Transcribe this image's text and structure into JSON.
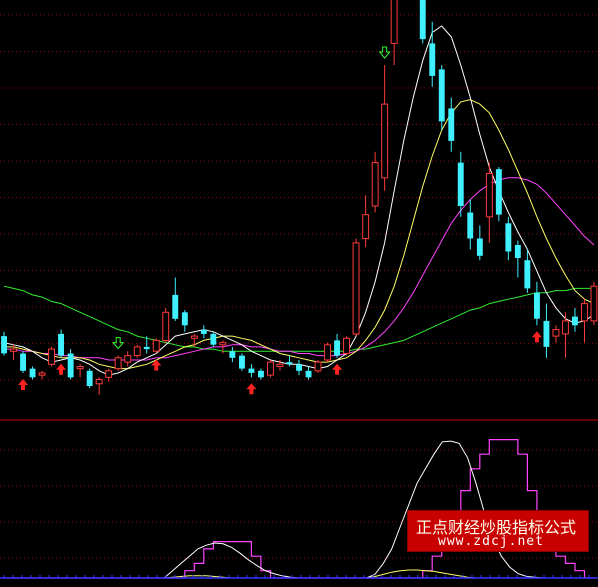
{
  "colors": {
    "background": "#000000",
    "grid": "#8b0000",
    "divider": "#cc0000",
    "up_candle": "#ff3b3b",
    "down_candle": "#3ff0ff",
    "ma_short": "#ffffff",
    "ma_mid": "#ffff66",
    "ma_long": "#ff44ff",
    "ma_longest": "#33ee33",
    "buy_arrow": "#ff2222",
    "sell_arrow": "#33ff33",
    "indicator_step": "#ff44ff",
    "indicator_smooth": "#ffffff",
    "indicator_low": "#ffff66",
    "baseline": "#3333ff"
  },
  "chart_data": {
    "type": "candlestick",
    "grid": true,
    "candles": [
      {
        "o": 55,
        "h": 57,
        "l": 46,
        "c": 47
      },
      {
        "o": 48,
        "h": 51,
        "l": 44,
        "c": 49
      },
      {
        "o": 47,
        "h": 48,
        "l": 38,
        "c": 39
      },
      {
        "o": 40,
        "h": 41,
        "l": 35,
        "c": 36
      },
      {
        "o": 37,
        "h": 39,
        "l": 35,
        "c": 38
      },
      {
        "o": 42,
        "h": 50,
        "l": 41,
        "c": 49
      },
      {
        "o": 56,
        "h": 58,
        "l": 45,
        "c": 46
      },
      {
        "o": 47,
        "h": 49,
        "l": 35,
        "c": 36
      },
      {
        "o": 40,
        "h": 42,
        "l": 36,
        "c": 41
      },
      {
        "o": 39,
        "h": 40,
        "l": 31,
        "c": 32
      },
      {
        "o": 33,
        "h": 36,
        "l": 28,
        "c": 35
      },
      {
        "o": 36,
        "h": 40,
        "l": 34,
        "c": 39
      },
      {
        "o": 40,
        "h": 46,
        "l": 39,
        "c": 45
      },
      {
        "o": 43,
        "h": 48,
        "l": 41,
        "c": 46
      },
      {
        "o": 46,
        "h": 51,
        "l": 45,
        "c": 50
      },
      {
        "o": 50,
        "h": 55,
        "l": 47,
        "c": 49
      },
      {
        "o": 48,
        "h": 54,
        "l": 47,
        "c": 53
      },
      {
        "o": 53,
        "h": 68,
        "l": 52,
        "c": 66
      },
      {
        "o": 74,
        "h": 82,
        "l": 62,
        "c": 63
      },
      {
        "o": 66,
        "h": 67,
        "l": 57,
        "c": 60
      },
      {
        "o": 54,
        "h": 56,
        "l": 50,
        "c": 55
      },
      {
        "o": 58,
        "h": 60,
        "l": 54,
        "c": 56
      },
      {
        "o": 56,
        "h": 57,
        "l": 50,
        "c": 51
      },
      {
        "o": 51,
        "h": 53,
        "l": 47,
        "c": 52
      },
      {
        "o": 48,
        "h": 50,
        "l": 43,
        "c": 45
      },
      {
        "o": 46,
        "h": 47,
        "l": 39,
        "c": 40
      },
      {
        "o": 40,
        "h": 42,
        "l": 36,
        "c": 38
      },
      {
        "o": 39,
        "h": 40,
        "l": 35,
        "c": 36
      },
      {
        "o": 37,
        "h": 44,
        "l": 36,
        "c": 43
      },
      {
        "o": 41,
        "h": 44,
        "l": 39,
        "c": 42
      },
      {
        "o": 43,
        "h": 46,
        "l": 41,
        "c": 42
      },
      {
        "o": 42,
        "h": 44,
        "l": 37,
        "c": 39
      },
      {
        "o": 39,
        "h": 41,
        "l": 35,
        "c": 36
      },
      {
        "o": 39,
        "h": 44,
        "l": 38,
        "c": 43
      },
      {
        "o": 44,
        "h": 52,
        "l": 43,
        "c": 51
      },
      {
        "o": 53,
        "h": 56,
        "l": 45,
        "c": 46
      },
      {
        "o": 47,
        "h": 55,
        "l": 46,
        "c": 54
      },
      {
        "o": 56,
        "h": 100,
        "l": 55,
        "c": 98
      },
      {
        "o": 100,
        "h": 120,
        "l": 96,
        "c": 111
      },
      {
        "o": 115,
        "h": 140,
        "l": 112,
        "c": 135
      },
      {
        "o": 128,
        "h": 180,
        "l": 122,
        "c": 162
      },
      {
        "o": 190,
        "h": 240,
        "l": 180,
        "c": 232
      },
      {
        "o": 230,
        "h": 240,
        "l": 210,
        "c": 225
      },
      {
        "o": 232,
        "h": 240,
        "l": 220,
        "c": 226
      },
      {
        "o": 215,
        "h": 225,
        "l": 190,
        "c": 192
      },
      {
        "o": 190,
        "h": 200,
        "l": 170,
        "c": 175
      },
      {
        "o": 178,
        "h": 180,
        "l": 150,
        "c": 154
      },
      {
        "o": 160,
        "h": 165,
        "l": 140,
        "c": 145
      },
      {
        "o": 135,
        "h": 140,
        "l": 110,
        "c": 115
      },
      {
        "o": 112,
        "h": 118,
        "l": 95,
        "c": 100
      },
      {
        "o": 100,
        "h": 106,
        "l": 90,
        "c": 92
      },
      {
        "o": 110,
        "h": 135,
        "l": 98,
        "c": 130
      },
      {
        "o": 132,
        "h": 133,
        "l": 108,
        "c": 111
      },
      {
        "o": 107,
        "h": 110,
        "l": 90,
        "c": 94
      },
      {
        "o": 97,
        "h": 99,
        "l": 82,
        "c": 91
      },
      {
        "o": 90,
        "h": 95,
        "l": 75,
        "c": 77
      },
      {
        "o": 75,
        "h": 80,
        "l": 60,
        "c": 63
      },
      {
        "o": 62,
        "h": 70,
        "l": 45,
        "c": 50
      },
      {
        "o": 55,
        "h": 60,
        "l": 52,
        "c": 58
      },
      {
        "o": 56,
        "h": 66,
        "l": 45,
        "c": 62
      },
      {
        "o": 64,
        "h": 68,
        "l": 57,
        "c": 60
      },
      {
        "o": 62,
        "h": 72,
        "l": 52,
        "c": 70
      },
      {
        "o": 62,
        "h": 80,
        "l": 60,
        "c": 78
      }
    ],
    "ma_short": [
      52,
      51,
      50,
      48,
      45,
      43,
      44,
      45,
      44,
      42,
      39,
      37,
      38,
      40,
      43,
      45,
      47,
      51,
      55,
      56,
      57,
      58,
      57,
      55,
      53,
      51,
      48,
      46,
      44,
      43,
      42,
      42,
      41,
      40,
      41,
      44,
      47,
      55,
      66,
      80,
      98,
      122,
      145,
      165,
      182,
      195,
      198,
      193,
      180,
      165,
      148,
      133,
      122,
      112,
      103,
      95,
      85,
      75,
      68,
      63,
      61,
      62,
      65
    ],
    "ma_mid": [
      50,
      50,
      49,
      48,
      47,
      46,
      45,
      45,
      45,
      44,
      42,
      41,
      40,
      40,
      41,
      42,
      44,
      46,
      48,
      50,
      51,
      53,
      54,
      55,
      55,
      54,
      53,
      51,
      49,
      47,
      46,
      45,
      44,
      43,
      43,
      44,
      45,
      48,
      53,
      59,
      67,
      78,
      92,
      108,
      124,
      138,
      150,
      158,
      163,
      164,
      162,
      158,
      150,
      141,
      131,
      121,
      110,
      100,
      91,
      83,
      76,
      72,
      70
    ],
    "ma_long": [
      49,
      49,
      48,
      48,
      47,
      47,
      46,
      46,
      45,
      45,
      45,
      44,
      44,
      44,
      44,
      44,
      45,
      45,
      46,
      47,
      48,
      49,
      50,
      50,
      51,
      51,
      50,
      50,
      49,
      48,
      48,
      47,
      47,
      46,
      46,
      46,
      47,
      48,
      50,
      53,
      57,
      62,
      68,
      75,
      83,
      91,
      99,
      107,
      113,
      118,
      122,
      125,
      127,
      128,
      128,
      127,
      125,
      121,
      116,
      111,
      106,
      101,
      97
    ],
    "ma_longest": [
      78,
      77,
      76,
      74,
      73,
      71,
      70,
      68,
      66,
      64,
      62,
      60,
      58,
      57,
      55,
      54,
      53,
      52,
      51,
      50,
      50,
      49,
      49,
      48,
      48,
      48,
      48,
      48,
      48,
      48,
      48,
      48,
      48,
      48,
      48,
      48,
      48,
      49,
      49,
      50,
      51,
      52,
      53,
      55,
      57,
      59,
      61,
      63,
      65,
      67,
      68,
      70,
      71,
      72,
      73,
      74,
      75,
      75,
      76,
      76,
      77,
      77,
      77
    ],
    "buy_signals": [
      2,
      6,
      16,
      26,
      35,
      56
    ],
    "sell_signals": [
      12,
      40
    ],
    "indicator_step": [
      0,
      0,
      0,
      0,
      0,
      0,
      0,
      0,
      0,
      0,
      0,
      0,
      0,
      0,
      0,
      0,
      0,
      0,
      0,
      1,
      2,
      4,
      5,
      5,
      5,
      5,
      3,
      1,
      0,
      0,
      0,
      0,
      0,
      0,
      0,
      0,
      0,
      0,
      0,
      0,
      0,
      0,
      0,
      0,
      1,
      3,
      6,
      9,
      12,
      15,
      17,
      19,
      19,
      19,
      17,
      12,
      8,
      5,
      3,
      2,
      1,
      0,
      0
    ],
    "indicator_smooth": [
      0,
      0,
      0,
      0,
      0,
      0,
      0,
      0,
      0,
      0,
      0,
      0,
      0,
      0,
      0,
      0,
      0,
      0,
      0,
      0,
      1,
      2,
      3,
      4,
      4.5,
      4.8,
      4.7,
      4.2,
      3.4,
      2.5,
      1.7,
      1,
      0.6,
      0.3,
      0.1,
      0,
      0,
      0,
      0,
      0,
      0,
      0,
      0,
      0,
      0.5,
      2,
      4,
      7,
      10,
      13,
      15,
      17,
      18.7,
      18.8,
      18.5,
      16.5,
      13,
      9,
      5.5,
      3,
      1.5,
      0.6,
      0.2,
      0.1,
      0,
      0,
      0,
      0,
      0,
      0,
      0
    ],
    "indicator_low": [
      0,
      0,
      0,
      0,
      0,
      0,
      0,
      0,
      0,
      0,
      0,
      0,
      0,
      0,
      0,
      0,
      0,
      0,
      0,
      0,
      0.1,
      0.2,
      0.3,
      0.3,
      0.3,
      0.2,
      0.1,
      0,
      0,
      0,
      0,
      0,
      0,
      0,
      0,
      0,
      0,
      0,
      0,
      0,
      0,
      0,
      0,
      0,
      0.2,
      0.5,
      0.8,
      1,
      1.1,
      1.1,
      1,
      0.9,
      0.7,
      0.5,
      0.3,
      0.1,
      0,
      0,
      0,
      0,
      0,
      0,
      0
    ]
  },
  "watermark": {
    "title": "正点财经炒股指标公式",
    "url": "www.zdcj.net"
  }
}
